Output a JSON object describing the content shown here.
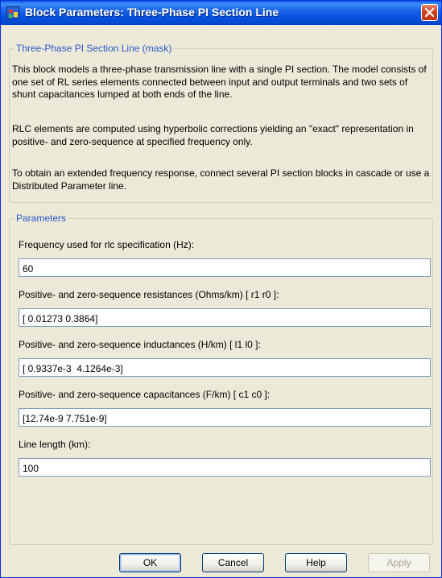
{
  "window": {
    "title": "Block Parameters: Three-Phase PI Section Line"
  },
  "mask": {
    "legend": "Three-Phase PI Section Line (mask)",
    "paragraphs": [
      "This block models a three-phase transmission line with a single PI section. The model consists of one set of RL series elements connected between input and output terminals and two sets of shunt capacitances lumped at both ends of the line.",
      "RLC elements are computed using hyperbolic corrections yielding an \"exact\" representation in positive- and zero-sequence at specified frequency only.",
      "To obtain an extended frequency response, connect several PI section blocks in cascade or use a Distributed Parameter line."
    ]
  },
  "parameters": {
    "legend": "Parameters",
    "fields": [
      {
        "label": "Frequency used for rlc specification (Hz):",
        "value": "60"
      },
      {
        "label": "Positive- and zero-sequence resistances (Ohms/km) [ r1  r0 ]:",
        "value": "[ 0.01273 0.3864]"
      },
      {
        "label": "Positive- and zero-sequence inductances (H/km) [ l1  l0 ]:",
        "value": "[ 0.9337e-3  4.1264e-3]"
      },
      {
        "label": "Positive- and zero-sequence capacitances (F/km) [ c1 c0 ]:",
        "value": "[12.74e-9 7.751e-9]"
      },
      {
        "label": "Line length (km):",
        "value": "100"
      }
    ]
  },
  "buttons": {
    "ok": "OK",
    "cancel": "Cancel",
    "help": "Help",
    "apply": "Apply"
  }
}
